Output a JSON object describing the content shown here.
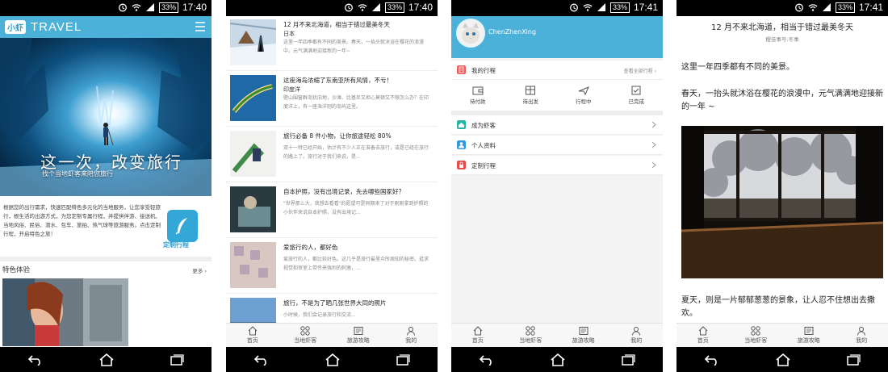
{
  "status_bar": {
    "battery": "33%",
    "times": [
      "17:40",
      "17:40",
      "17:41",
      "17:41"
    ]
  },
  "home": {
    "logo_badge": "小虾",
    "logo_text": "TRAVEL",
    "hero_title": "这一次，改变旅行",
    "hero_subtitle": "找个当地虾客来陪您旅行",
    "intro": "根据您的出行需求，快速匹配特色多元化的当地服务，让您享受轻旅行，根生活的出游方式，为您定制专属行程，并提供伴游、接送机、当地风俗、民俗、潜水、包车、旅拍、热气球等旅游服务。点击定制行程，开启特色之旅！",
    "custom_label": "定制行程",
    "section_title": "特色体验",
    "more": "更多"
  },
  "tabs": [
    "首页",
    "当地虾客",
    "旅游攻略",
    "我的"
  ],
  "articles": [
    {
      "title": "12 月不来北海道，相当于错过最美冬天",
      "location": "日本",
      "desc": "这里一年四季都有不同的美景。春天，一抬头就沐浴在樱花的浪漫中，元气满满地迎接新的一年~"
    },
    {
      "title": "这座海岛浓缩了东南亚所有风情，不亏！",
      "location": "印度洋",
      "desc": "壁山围窗群岛犹旧地，沙滩、比基尼又担心莫顿又不够怎么办？在印度洋上，有一座海洋则的岛屿这里。"
    },
    {
      "title": "旅行必备 8 件小物，让你旅途轻松 80%",
      "location": "",
      "desc": "双十一特已经开始，估计有不少人正在准备去旅行，或是已经在旅行的路上了。旅行对于我们来说，是..."
    },
    {
      "title": "自本护照，没有出境记录，先去哪些国家好？",
      "location": "",
      "desc": "\"世界那么大，我想去看看\"的愿望可是同期来了对于刚刚拿到护照的小伙伴来说自本护照，没有出境记..."
    },
    {
      "title": "爱旅行的人，都好色",
      "location": "",
      "desc": "爱旅行的人，都比较好色。这几乎是旅行最里众所周知的秘密。逛求视觉和审室上带传来强烈的刺激，..."
    },
    {
      "title": "旅行，不是为了晒几张世界大同的照片",
      "location": "",
      "desc": "小时候，我们会记录旅行和交流..."
    }
  ],
  "profile": {
    "username": "ChenZhenXing",
    "my_trips": "我的行程",
    "view_all": "查看全部行程",
    "orders": [
      "待付款",
      "待出发",
      "行程中",
      "已完成"
    ],
    "menu": [
      "成为虾客",
      "个人资料",
      "定制行程"
    ]
  },
  "article": {
    "title": "12 月不来北海道，相当于错过最美冬天",
    "author": "樱佳事号:冬事",
    "p1": "这里一年四季都有不同的美景。",
    "p2": "春天，一抬头就沐浴在樱花的浪漫中，元气满满地迎接新的一年 ~",
    "p3": "夏天，则是一片郁郁葱葱的景象，让人忍不住想出去撒欢。"
  },
  "colors": {
    "brand": "#4bb1d8",
    "trip_red": "#f15d5d",
    "teal": "#26b3a5",
    "blue": "#3397e0",
    "red": "#e84a4a"
  }
}
